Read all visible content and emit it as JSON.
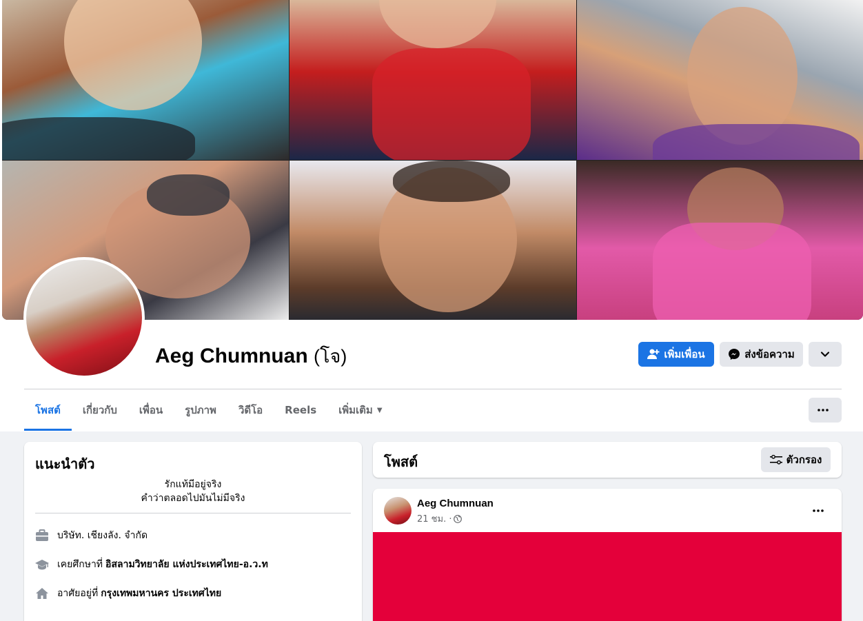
{
  "profile": {
    "name": "Aeg Chumnuan",
    "alternate_name": "(โจ)",
    "buttons": {
      "add_friend": "เพิ่มเพื่อน",
      "message": "ส่งข้อความ"
    }
  },
  "tabs": [
    {
      "label": "โพสต์",
      "active": true
    },
    {
      "label": "เกี่ยวกับ"
    },
    {
      "label": "เพื่อน"
    },
    {
      "label": "รูปภาพ"
    },
    {
      "label": "วิดีโอ"
    },
    {
      "label": "Reels"
    },
    {
      "label": "เพิ่มเติม"
    }
  ],
  "intro": {
    "title": "แนะนำตัว",
    "bio_line1": "รักแท้มีอยู่จริง",
    "bio_line2": "คำว่าตลอดไปมันไม่มีจริง",
    "work": {
      "text": "บริษัท. เชียงลัง. จำกัด"
    },
    "education": {
      "prefix": "เคยศึกษาที่",
      "value": "อิสลามวิทยาลัย แห่งประเทศไทย-อ.ว.ท"
    },
    "home": {
      "prefix": "อาศัยอยู่ที่",
      "value": "กรุงเทพมหานคร ประเทศไทย"
    }
  },
  "posts": {
    "title": "โพสต์",
    "filter_label": "ตัวกรอง",
    "items": [
      {
        "author": "Aeg Chumnuan",
        "time": "21 ชม. ·",
        "media_color": "#e4003a"
      }
    ]
  },
  "colors": {
    "accent": "#1b74e4",
    "background": "#f0f2f5",
    "button_gray": "#e4e6eb"
  }
}
